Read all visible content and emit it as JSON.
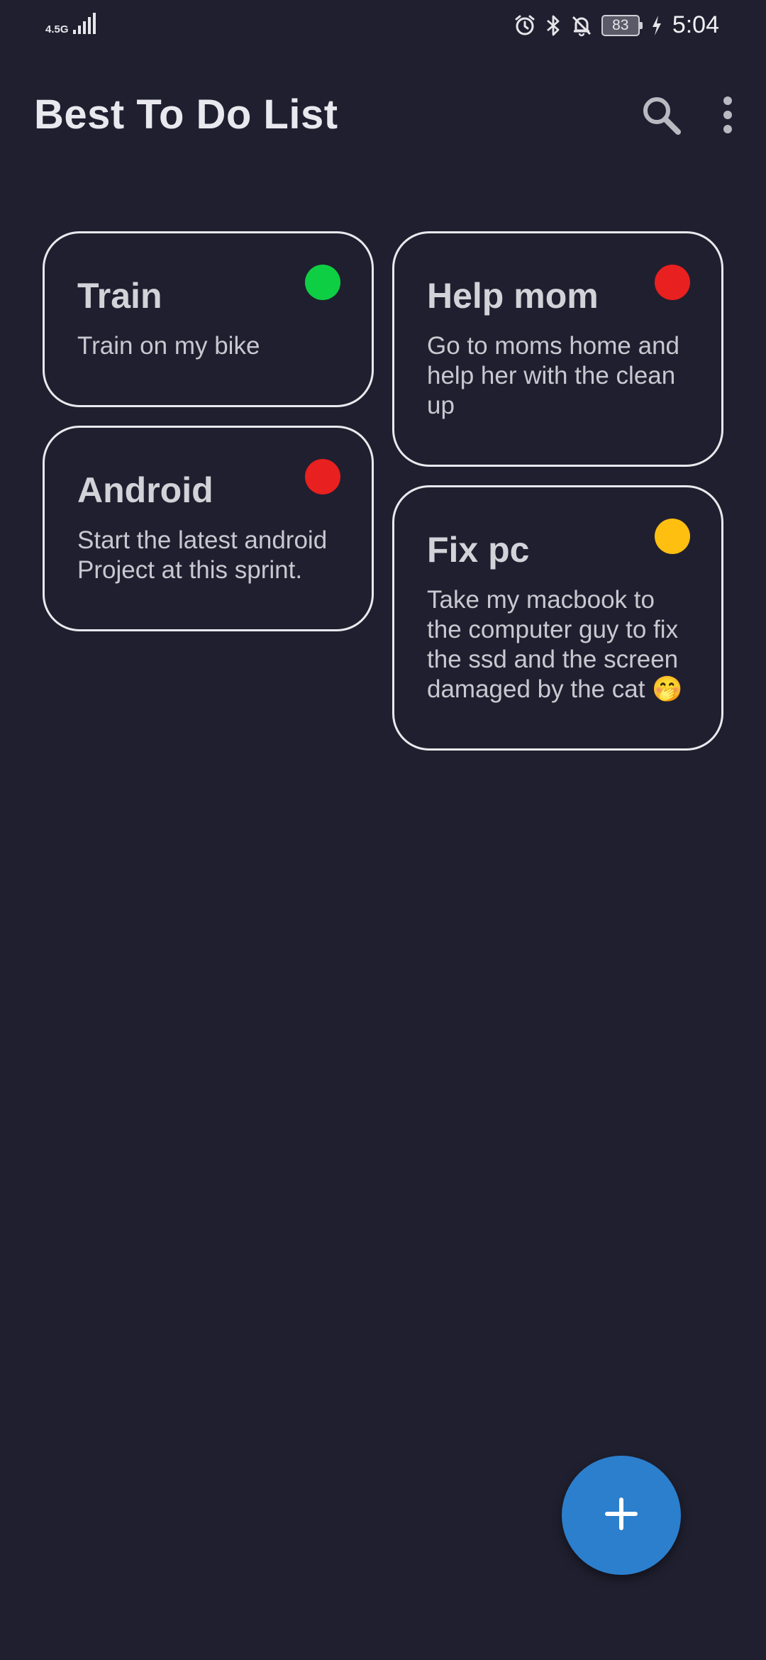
{
  "status_bar": {
    "network": "4.5G",
    "battery": "83",
    "time": "5:04"
  },
  "app_bar": {
    "title": "Best To Do List",
    "icons": [
      "search-icon",
      "more-vert-icon"
    ]
  },
  "notes": [
    {
      "title": "Train",
      "body": "Train on my bike",
      "priority_color": "#0ecf43"
    },
    {
      "title": "Help mom",
      "body": "Go to moms home and help her with the clean up",
      "priority_color": "#e8201f"
    },
    {
      "title": "Android",
      "body": "Start the latest android Project at this sprint.",
      "priority_color": "#e8201f"
    },
    {
      "title": "Fix pc",
      "body": "Take my macbook to the computer guy to fix the ssd and the screen damaged by the cat 🤭",
      "priority_color": "#ffbf10"
    }
  ],
  "fab": {
    "icon": "add-icon",
    "color": "#2c7fcc"
  },
  "colors": {
    "background": "#201f2f",
    "card_border": "#e9e9ee",
    "accent": "#2c7fcc"
  }
}
